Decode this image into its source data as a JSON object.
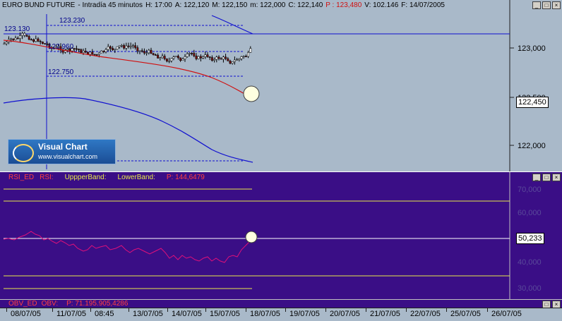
{
  "header": {
    "instrument": "EURO BUND FUTURE",
    "timeframe": "- Intradía 45 minutos",
    "h": "H: 17:00",
    "a": "A: 122,120",
    "m": "M: 122,150",
    "min": "m: 122,000",
    "c": "C: 122,140",
    "p": "P : 123,480",
    "v": "V: 102.146",
    "f": "F: 14/07/2005"
  },
  "price_axis": [
    "123,000",
    "122,500",
    "122,000"
  ],
  "last_price": "122,450",
  "levels": [
    "123.230",
    "123.130",
    "122.960",
    "122.750"
  ],
  "logo": {
    "name": "Visual Chart",
    "url": "www.visualchart.com"
  },
  "rsi": {
    "name": "RSI_ED",
    "field": "RSI:",
    "field_value": "",
    "upper_label": "UppperBand:",
    "upper_value": "",
    "lower_label": "LowerBand:",
    "lower_value": "",
    "p_value": "P: 144,6479",
    "axis": [
      "70,000",
      "60,000",
      "50,000",
      "40,000",
      "30,000"
    ],
    "last_value": "50,233"
  },
  "obv": {
    "name": "OBV_ED",
    "field": "OBV:",
    "field_value": "",
    "p_value": "P: 71.195.905,4286"
  },
  "dates": [
    "08/07/05",
    "11/07/05",
    "08:45",
    "13/07/05",
    "14/07/05",
    "15/07/05",
    "18/07/05",
    "19/07/05",
    "20/07/05",
    "21/07/05",
    "22/07/05",
    "25/07/05",
    "26/07/05"
  ],
  "colors": {
    "price_bg": "#a9b9c9",
    "rsi_bg": "#3a0e86",
    "ma_red": "#d01010",
    "band_blue": "#1010d0",
    "rsi_line": "#e0107a",
    "band_yellow": "#e8e84a"
  },
  "icons": [
    "minimize-icon",
    "maximize-icon",
    "close-icon"
  ]
}
